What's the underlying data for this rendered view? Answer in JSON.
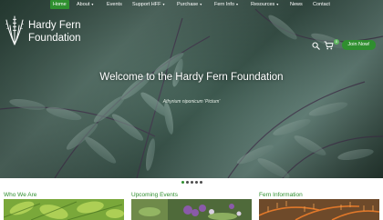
{
  "nav": {
    "items": [
      {
        "label": "Home",
        "has_menu": false
      },
      {
        "label": "About",
        "has_menu": true
      },
      {
        "label": "Events",
        "has_menu": false
      },
      {
        "label": "Support HFF",
        "has_menu": true
      },
      {
        "label": "Purchase",
        "has_menu": true
      },
      {
        "label": "Fern Info",
        "has_menu": true
      },
      {
        "label": "Resources",
        "has_menu": true
      },
      {
        "label": "News",
        "has_menu": false
      },
      {
        "label": "Contact",
        "has_menu": false
      }
    ],
    "active": "Home"
  },
  "logo": {
    "line1": "Hardy Fern",
    "line2": "Foundation"
  },
  "header_actions": {
    "cart_count": "0",
    "join_label": "Join Now!"
  },
  "hero": {
    "title": "Welcome to the Hardy Fern Foundation",
    "caption": "Athyrium niponicum 'Pictum'"
  },
  "slider": {
    "count": 5,
    "active_index": 0
  },
  "sections": {
    "who": "Who We Are",
    "events": "Upcoming Events",
    "fern_info": "Fern Information"
  },
  "colors": {
    "accent": "#2f8f2f",
    "white": "#ffffff"
  }
}
